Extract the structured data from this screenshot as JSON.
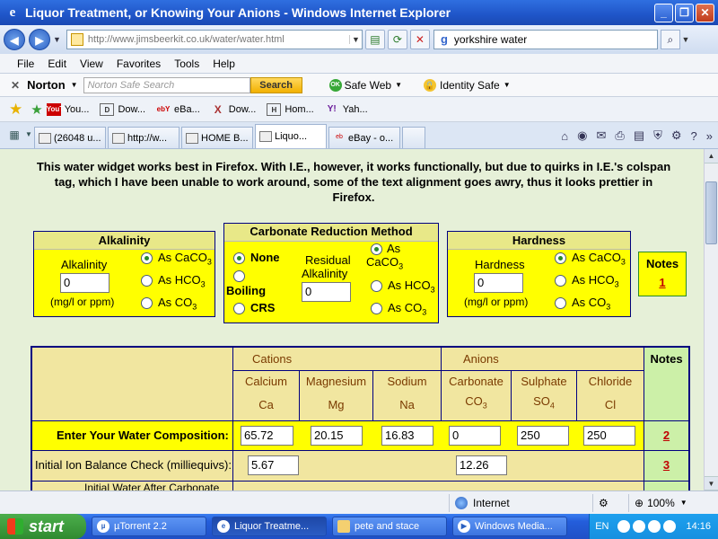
{
  "window": {
    "title": "Liquor Treatment, or Knowing Your Anions - Windows Internet Explorer"
  },
  "address": {
    "url": "http://www.jimsbeerkit.co.uk/water/water.html",
    "search_value": "yorkshire water"
  },
  "menu": [
    "File",
    "Edit",
    "View",
    "Favorites",
    "Tools",
    "Help"
  ],
  "norton": {
    "brand": "Norton",
    "search_placeholder": "Norton Safe Search",
    "search_button": "Search",
    "safe_web": "Safe Web",
    "identity_safe": "Identity Safe"
  },
  "favorites": [
    {
      "icon": "YouTube",
      "label": "You..."
    },
    {
      "icon": "D",
      "label": "Dow..."
    },
    {
      "icon": "ebY",
      "label": "eBa..."
    },
    {
      "icon": "X",
      "label": "Dow..."
    },
    {
      "icon": "H",
      "label": "Hom..."
    },
    {
      "icon": "Y!",
      "label": "Yah..."
    }
  ],
  "tabs": [
    {
      "label": "(26048 u...",
      "active": false
    },
    {
      "label": "http://w...",
      "active": false
    },
    {
      "label": "HOME B...",
      "active": false
    },
    {
      "label": "Liquo...",
      "active": true
    },
    {
      "label": "eBay - o...",
      "active": false
    }
  ],
  "page": {
    "intro": "This water widget works best in Firefox. With I.E., however, it works functionally, but due to quirks in I.E.'s colspan tag, which I have been unable to work around, some of the text alignment goes awry, thus it looks prettier in Firefox.",
    "alkalinity": {
      "header": "Alkalinity",
      "label": "Alkalinity",
      "value": "0",
      "unit": "(mg/l or ppm)",
      "options": [
        {
          "text": "As CaCO",
          "sub": "3",
          "selected": true
        },
        {
          "text": "As HCO",
          "sub": "3",
          "selected": false
        },
        {
          "text": "As CO",
          "sub": "3",
          "selected": false
        }
      ]
    },
    "carbonate": {
      "header": "Carbonate Reduction Method",
      "methods": [
        {
          "text": "None",
          "selected": true
        },
        {
          "text": "Boiling",
          "selected": false
        },
        {
          "text": "CRS",
          "selected": false
        }
      ],
      "residual_label_1": "Residual",
      "residual_label_2": "Alkalinity",
      "residual_value": "0",
      "options": [
        {
          "text": "As",
          "text2": "CaCO",
          "sub": "3",
          "selected": true
        },
        {
          "text": "As HCO",
          "sub": "3",
          "selected": false
        },
        {
          "text": "As CO",
          "sub": "3",
          "selected": false
        }
      ]
    },
    "hardness": {
      "header": "Hardness",
      "label": "Hardness",
      "value": "0",
      "unit": "(mg/l or ppm)",
      "options": [
        {
          "text": "As CaCO",
          "sub": "3",
          "selected": true
        },
        {
          "text": "As HCO",
          "sub": "3",
          "selected": false
        },
        {
          "text": "As CO",
          "sub": "3",
          "selected": false
        }
      ]
    },
    "notes_box": {
      "label": "Notes",
      "link": "1"
    },
    "table": {
      "cations_label": "Cations",
      "anions_label": "Anions",
      "notes_label": "Notes",
      "ions": [
        {
          "name": "Calcium",
          "symbol": "Ca",
          "sub": ""
        },
        {
          "name": "Magnesium",
          "symbol": "Mg",
          "sub": ""
        },
        {
          "name": "Sodium",
          "symbol": "Na",
          "sub": ""
        },
        {
          "name": "Carbonate",
          "symbol": "CO",
          "sub": "3"
        },
        {
          "name": "Sulphate",
          "symbol": "SO",
          "sub": "4"
        },
        {
          "name": "Chloride",
          "symbol": "Cl",
          "sub": ""
        }
      ],
      "composition_label": "Enter Your Water Composition:",
      "composition_values": [
        "65.72",
        "20.15",
        "16.83",
        "0",
        "250",
        "250"
      ],
      "composition_note": "2",
      "balance_label": "Initial Ion Balance Check (milliequivs):",
      "balance_cation": "5.67",
      "balance_anion": "12.26",
      "balance_note": "3",
      "partial_row_label": "Initial Water After Carbonate"
    }
  },
  "status": {
    "zone": "Internet",
    "zoom": "100%"
  },
  "taskbar": {
    "start": "start",
    "tasks": [
      {
        "label": "µTorrent 2.2",
        "active": false
      },
      {
        "label": "Liquor Treatme...",
        "active": true
      },
      {
        "label": "pete and stace",
        "active": false
      },
      {
        "label": "Windows Media...",
        "active": false
      }
    ],
    "lang": "EN",
    "clock": "14:16"
  }
}
